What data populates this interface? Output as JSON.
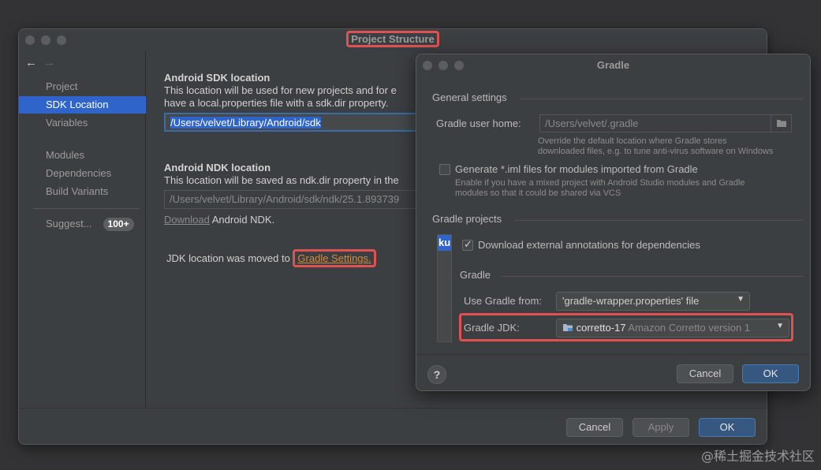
{
  "main_window": {
    "title": "Project Structure",
    "sidebar": {
      "items": [
        {
          "label": "Project"
        },
        {
          "label": "SDK Location",
          "selected": true
        },
        {
          "label": "Variables"
        },
        {
          "label": "Modules"
        },
        {
          "label": "Dependencies"
        },
        {
          "label": "Build Variants"
        }
      ],
      "suggestions": {
        "label": "Suggest...",
        "badge": "100+"
      }
    },
    "sdk": {
      "title": "Android SDK location",
      "desc_line1": "This location will be used for new projects and for e",
      "desc_line2": "have a local.properties file with a sdk.dir property.",
      "value": "/Users/velvet/Library/Android/sdk"
    },
    "ndk": {
      "title": "Android NDK location",
      "desc": "This location will be saved as ndk.dir property in the",
      "value": "/Users/velvet/Library/Android/sdk/ndk/25.1.893739",
      "download_link": "Download",
      "download_suffix": "Android NDK."
    },
    "jdk": {
      "text": "JDK location was moved to",
      "link": "Gradle Settings."
    },
    "buttons": {
      "cancel": "Cancel",
      "apply": "Apply",
      "ok": "OK"
    }
  },
  "gradle_dialog": {
    "title": "Gradle",
    "general": {
      "section_title": "General settings",
      "user_home_label": "Gradle user home:",
      "user_home_value": "/Users/velvet/.gradle",
      "user_home_hint_line1": "Override the default location where Gradle stores",
      "user_home_hint_line2": "downloaded files, e.g. to tune anti-virus software on Windows",
      "iml_label": "Generate *.iml files for modules imported from Gradle",
      "iml_hint_line1": "Enable if you have a mixed project with Android Studio modules and Gradle",
      "iml_hint_line2": "modules so that it could be shared via VCS"
    },
    "projects": {
      "section_title": "Gradle projects",
      "list_item": "kur",
      "download_annotations_label": "Download external annotations for dependencies",
      "gradle_group": "Gradle",
      "use_from_label": "Use Gradle from:",
      "use_from_value": "'gradle-wrapper.properties' file",
      "jdk_label": "Gradle JDK:",
      "jdk_value_name": "corretto-17",
      "jdk_value_desc": "Amazon Corretto version 1"
    },
    "buttons": {
      "help": "?",
      "cancel": "Cancel",
      "ok": "OK"
    }
  },
  "watermark": "@稀土掘金技术社区"
}
